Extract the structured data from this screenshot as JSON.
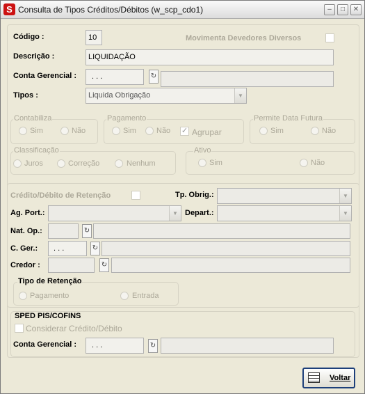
{
  "window": {
    "title": "Consulta de Tipos Créditos/Débitos (w_scp_cdo1)",
    "app_icon": "S",
    "controls": {
      "minimize": "minimize-icon",
      "maximize": "maximize-icon",
      "close": "close-icon"
    }
  },
  "header": {
    "codigo_label": "Código :",
    "codigo_value": "10",
    "movimenta_label": "Movimenta Devedores Diversos",
    "descricao_label": "Descrição :",
    "descricao_value": "LIQUIDAÇÃO",
    "conta_gerencial_label": "Conta Gerencial :",
    "conta_gerencial_value": ". . .",
    "tipos_label": "Tipos :",
    "tipos_value": "Liquida Obrigação"
  },
  "groups": {
    "contabiliza": {
      "label": "Contabiliza",
      "options": [
        "Sim",
        "Não"
      ]
    },
    "pagamento": {
      "label": "Pagamento",
      "options": [
        "Sim",
        "Não"
      ],
      "agrupar_label": "Agrupar"
    },
    "permite_data_futura": {
      "label": "Permite Data Futura",
      "options": [
        "Sim",
        "Não"
      ]
    },
    "classificacao": {
      "label": "Classificação",
      "options": [
        "Juros",
        "Correção",
        "Nenhum"
      ]
    },
    "ativo": {
      "label": "Ativo",
      "options": [
        "Sim",
        "Não"
      ]
    }
  },
  "retencao": {
    "credito_debito_label": "Crédito/Débito de Retenção",
    "tp_obrig_label": "Tp. Obrig.:",
    "ag_port_label": "Ag. Port.:",
    "depart_label": "Depart.:",
    "nat_op_label": "Nat. Op.:",
    "c_ger_label": "C. Ger.:",
    "c_ger_value": ". . .",
    "credor_label": "Credor :",
    "tipo_retencao_label": "Tipo de Retenção",
    "tipo_retencao_options": [
      "Pagamento",
      "Entrada"
    ]
  },
  "sped": {
    "title": "SPED PIS/COFINS",
    "considerar_label": "Considerar Crédito/Débito",
    "conta_gerencial_label": "Conta Gerencial :",
    "conta_gerencial_value": ". . ."
  },
  "footer": {
    "voltar_label": "Voltar",
    "voltar_icon": "table-icon"
  },
  "icons": {
    "lookup": "lookup-icon"
  },
  "colors": {
    "disabled_text": "#aca899",
    "window_bg": "#ece9d8",
    "app_icon_red": "#cc1111"
  }
}
